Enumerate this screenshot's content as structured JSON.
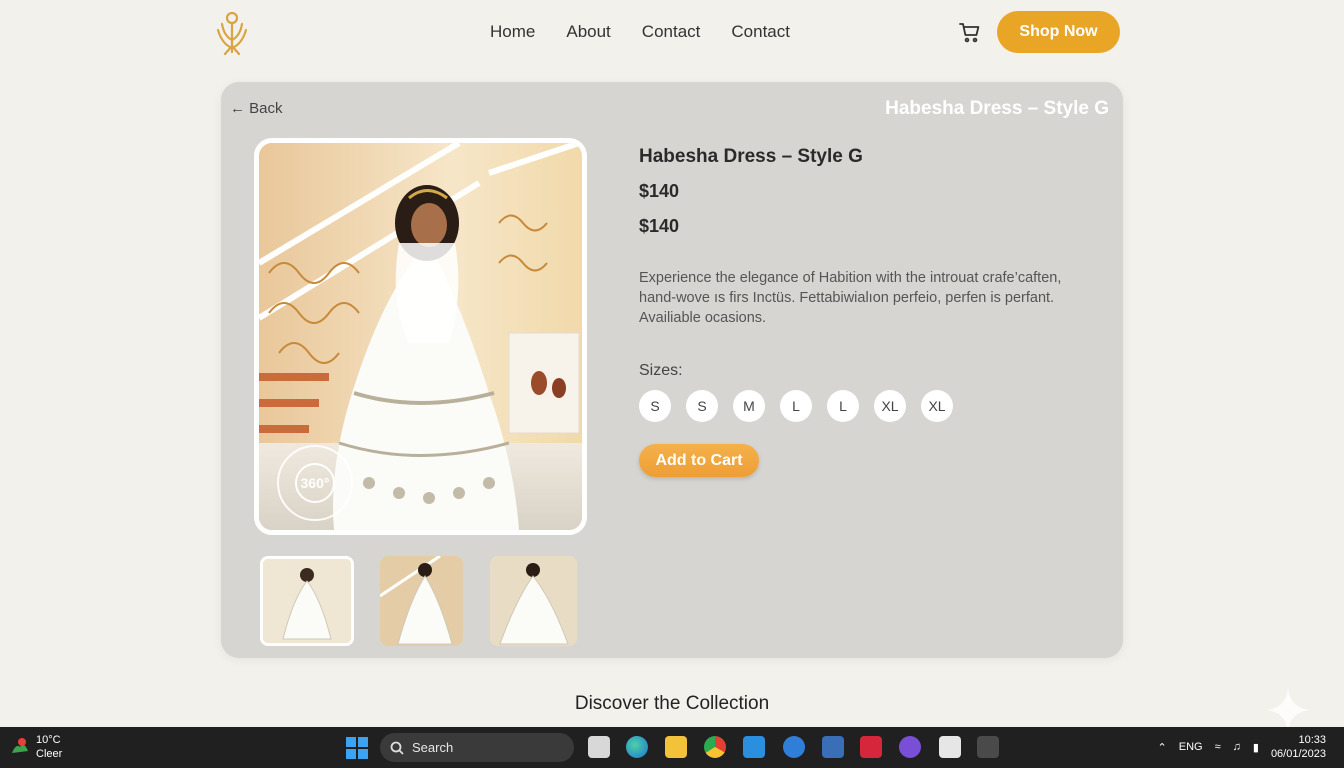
{
  "header": {
    "nav": [
      "Home",
      "About",
      "Contact",
      "Contact"
    ],
    "cta": "Shop Now"
  },
  "card": {
    "back_label": "← Back",
    "title_right": "Habesha Dress – Style G",
    "badge_360": "360°",
    "product": {
      "title": "Habesha Dress – Style G",
      "price": "$140",
      "price_secondary": "$140",
      "description": "Experience the elegance of Habition with the introuat crafe’caften, hand-wove ıs firs Inctüs. Fettabiwialıon perfeio, perfen is perfant. Availiable ocasions.",
      "sizes_label": "Sizes:",
      "sizes": [
        "S",
        "S",
        "M",
        "L",
        "L",
        "XL",
        "XL"
      ],
      "add_to_cart": "Add to Cart"
    }
  },
  "collection": {
    "title": "Discover the Collection"
  },
  "taskbar": {
    "weather_temp": "10°C",
    "weather_desc": "Cleer",
    "search_label": "Search",
    "lang": "ENG",
    "time": "10:33",
    "date": "06/01/2023"
  },
  "colors": {
    "accent": "#e9a526",
    "card_bg": "#d6d5d1",
    "page_bg": "#f3f1ec"
  }
}
